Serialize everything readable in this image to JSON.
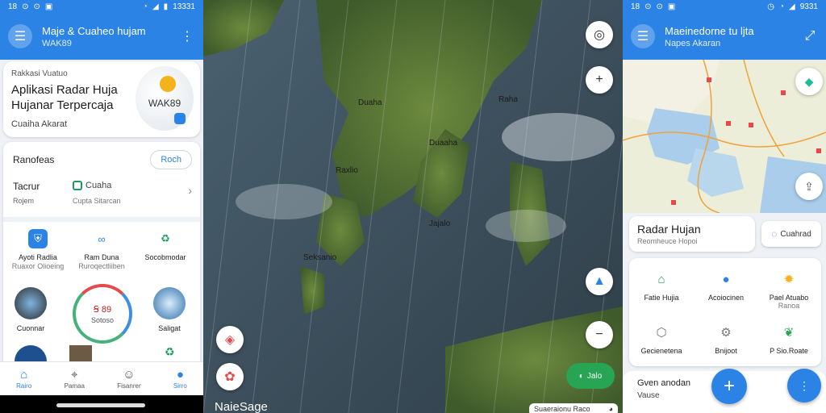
{
  "left": {
    "status": {
      "time_left": "18",
      "time_right": "13331"
    },
    "appbar": {
      "title": "Maje & Cuaheo hujam",
      "subtitle": "WAK89"
    },
    "hero": {
      "kicker": "Rakkasi Vuatuo",
      "title": "Aplikasi Radar Huja Hujanar Terpercaja",
      "subtitle": "Cuaiha Akarat",
      "logo_text": "WAK89"
    },
    "main": {
      "label": "Ranofeas",
      "pill": "Roch",
      "row": {
        "a": "Tacrur",
        "a_sub": "Rojem",
        "b": "Cuaha",
        "b_sub": "Cupta Sitarcan"
      },
      "grid": [
        {
          "l1": "Ayoti Radlia",
          "l2": "Ruaxor Olioeing"
        },
        {
          "l1": "Ram Duna",
          "l2": "Ruroqectliiben"
        },
        {
          "l1": "Socobmodar",
          "l2": ""
        }
      ],
      "circles": {
        "left_cap": "Cuonnar",
        "gauge_top": "Ꞩ 89",
        "gauge_bottom": "Sotoso",
        "right_cap": "Saligat"
      }
    },
    "nav": [
      {
        "label": "Rairo",
        "icon": "home-icon"
      },
      {
        "label": "Pamaa",
        "icon": "pin-icon"
      },
      {
        "label": "Fisanrer",
        "icon": "chat-icon"
      },
      {
        "label": "Sirro",
        "icon": "person-icon"
      }
    ]
  },
  "map": {
    "labels": [
      "Duaha",
      "Raha",
      "Duaaha",
      "Raxlio",
      "Jajalo",
      "Seksanio"
    ],
    "live_label": "Jalo",
    "footer": "NaieSage",
    "chip_text": "Suaeraionu Raco"
  },
  "right": {
    "status": {
      "time_left": "18",
      "time_right": "9331"
    },
    "appbar": {
      "title": "Maeinedorne tu ljta",
      "subtitle": "Napes Akaran"
    },
    "radar_card": {
      "title": "Radar Hujan",
      "subtitle": "Reomheuce Hopoi"
    },
    "chip": "Cuahrad",
    "tools": [
      {
        "l1": "Fatie Hujia",
        "l2": ""
      },
      {
        "l1": "Acoiocinen",
        "l2": ""
      },
      {
        "l1": "Pael Atuabo",
        "l2": "Ranoa"
      },
      {
        "l1": "Gecienetena",
        "l2": ""
      },
      {
        "l1": "Bnijoot",
        "l2": ""
      },
      {
        "l1": "P Sio.Roate",
        "l2": ""
      }
    ],
    "sheet": {
      "t1": "Gven anodan",
      "t2": "Vause"
    }
  },
  "colors": {
    "primary": "#2b83e6",
    "green": "#27a555"
  }
}
